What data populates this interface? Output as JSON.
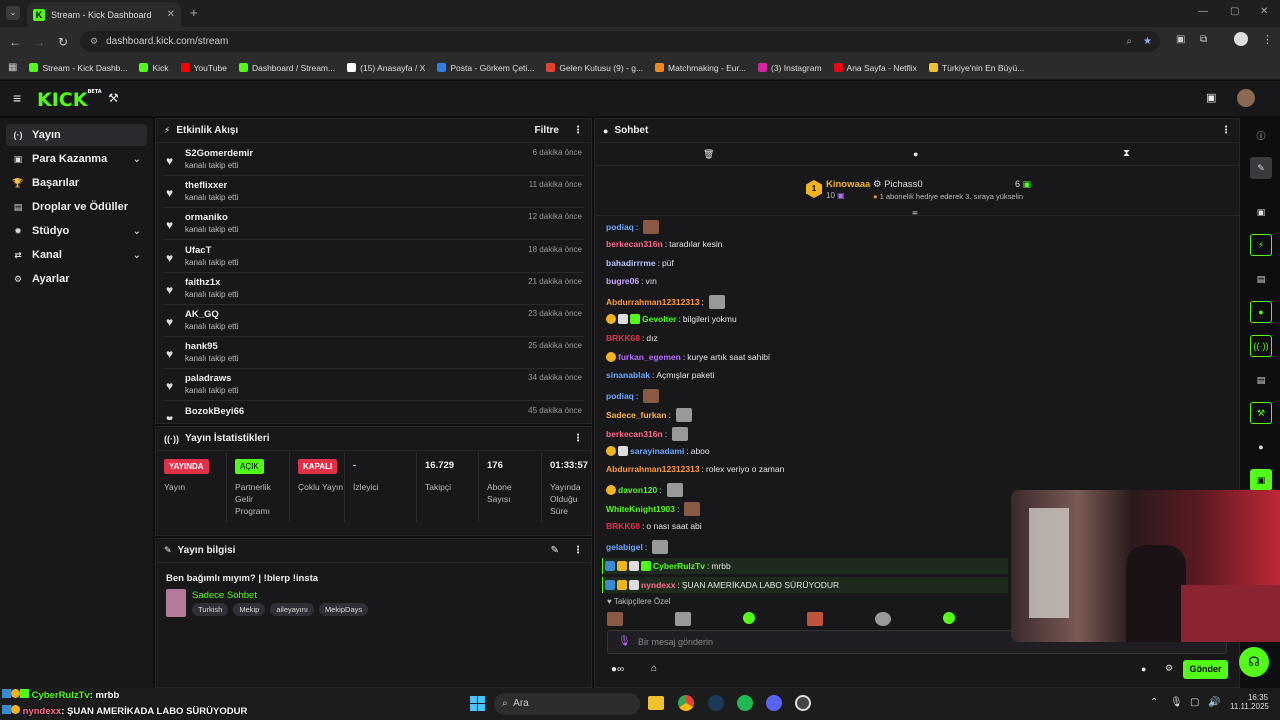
{
  "browser": {
    "tab_title": "Stream - Kick Dashboard",
    "url": "dashboard.kick.com/stream",
    "bookmarks": [
      {
        "label": "Stream - Kick Dashb...",
        "color": "#53fc18"
      },
      {
        "label": "Kick",
        "color": "#53fc18"
      },
      {
        "label": "YouTube",
        "color": "#ff0000"
      },
      {
        "label": "Dashboard / Stream...",
        "color": "#53fc18"
      },
      {
        "label": "(15) Anasayfa / X",
        "color": "#ffffff"
      },
      {
        "label": "Posta - Görkem Çeti...",
        "color": "#2f7fe6"
      },
      {
        "label": "Gelen Kutusu (9) - g...",
        "color": "#e34133"
      },
      {
        "label": "Matchmaking - Eur...",
        "color": "#f08a1c"
      },
      {
        "label": "(3) Instagram",
        "color": "#d6249f"
      },
      {
        "label": "Ana Sayfa - Netflix",
        "color": "#e50914"
      },
      {
        "label": "Türkiye'nin En Büyü...",
        "color": "#f2c12e"
      }
    ]
  },
  "header": {
    "logo": "KICK",
    "logo_tag": "BETA"
  },
  "sidebar": {
    "items": [
      {
        "label": "Yayın",
        "icon": "(·)",
        "chevron": false
      },
      {
        "label": "Para Kazanma",
        "icon": "▣",
        "chevron": true
      },
      {
        "label": "Başarılar",
        "icon": "🏆",
        "chevron": false
      },
      {
        "label": "Droplar ve Ödüller",
        "icon": "▤",
        "chevron": false
      },
      {
        "label": "Stüdyo",
        "icon": "✹",
        "chevron": true
      },
      {
        "label": "Kanal",
        "icon": "⇄",
        "chevron": true
      },
      {
        "label": "Ayarlar",
        "icon": "⚙",
        "chevron": false
      }
    ]
  },
  "activity": {
    "title": "Etkinlik Akışı",
    "filter": "Filtre",
    "items": [
      {
        "name": "S2Gomerdemir",
        "action": "kanalı takip etti",
        "time": "6 dakika önce"
      },
      {
        "name": "theflixxer",
        "action": "kanalı takip etti",
        "time": "11 dakika önce"
      },
      {
        "name": "ormaniko",
        "action": "kanalı takip etti",
        "time": "12 dakika önce"
      },
      {
        "name": "UfacT",
        "action": "kanalı takip etti",
        "time": "18 dakika önce"
      },
      {
        "name": "faithz1x",
        "action": "kanalı takip etti",
        "time": "21 dakika önce"
      },
      {
        "name": "AK_GQ",
        "action": "kanalı takip etti",
        "time": "23 dakika önce"
      },
      {
        "name": "hank95",
        "action": "kanalı takip etti",
        "time": "25 dakika önce"
      },
      {
        "name": "paladraws",
        "action": "kanalı takip etti",
        "time": "34 dakika önce"
      },
      {
        "name": "BozokBeyi66",
        "action": "",
        "time": "45 dakika önce"
      }
    ]
  },
  "stats": {
    "title": "Yayın İstatistikleri",
    "cols": [
      {
        "top": "YAYINDA",
        "top_style": "red",
        "label": "Yayın"
      },
      {
        "top": "AÇIK",
        "top_style": "green",
        "label": "Partnerlik Gelir Programı"
      },
      {
        "top": "KAPALI",
        "top_style": "red",
        "label": "Çoklu Yayın"
      },
      {
        "top": "-",
        "top_style": "text",
        "label": "İzleyici"
      },
      {
        "top": "16.729",
        "top_style": "text",
        "label": "Takipçi"
      },
      {
        "top": "176",
        "top_style": "text",
        "label": "Abone Sayısı"
      },
      {
        "top": "01:33:57",
        "top_style": "text",
        "label": "Yayında Olduğu Süre"
      }
    ]
  },
  "stream_info": {
    "title": "Yayın bilgisi",
    "stream_title": "Ben bağımlı mıyım? | !blerp !insta",
    "category": "Sadece Sohbet",
    "tags": [
      "Turkish",
      "Mekip",
      "aileyayını",
      "MekipDays"
    ]
  },
  "chat": {
    "title": "Sohbet",
    "top_gifter": {
      "name": "Kinowaaa",
      "count": "10"
    },
    "second": {
      "name": "Pichass0",
      "count": "6",
      "note": "1 abonelik hediye ederek 3. sıraya yükselin"
    },
    "messages": [
      {
        "user": "podiaq",
        "color": "#6aa8ff",
        "text": "",
        "emote": true,
        "badges": 0
      },
      {
        "user": "berkecan316n",
        "color": "#ff6b8b",
        "text": "taradılar kesin",
        "emote": false,
        "badges": 0
      },
      {
        "user": "bahadirrrme",
        "color": "#b0c4ff",
        "text": "püf",
        "emote": false,
        "badges": 0
      },
      {
        "user": "bugre06",
        "color": "#c9a8ff",
        "text": "vın",
        "emote": false,
        "badges": 0
      },
      {
        "user": "Abdurrahman12312313",
        "color": "#ff9a3c",
        "text": "",
        "emote": true,
        "badges": 0
      },
      {
        "user": "Gevolter",
        "color": "#53fc18",
        "text": "bilgileri yokmu",
        "emote": false,
        "badges": 3
      },
      {
        "user": "BRKK68",
        "color": "#e0304a",
        "text": "dız",
        "emote": false,
        "badges": 0
      },
      {
        "user": "furkan_egemen",
        "color": "#b86bff",
        "text": "kurye artık saat sahibi",
        "emote": false,
        "badges": 1
      },
      {
        "user": "sinanablak",
        "color": "#6aa8ff",
        "text": "Açmışlar paketi",
        "emote": false,
        "badges": 0
      },
      {
        "user": "podiaq",
        "color": "#6aa8ff",
        "text": "",
        "emote": true,
        "badges": 0
      },
      {
        "user": "Sadece_furkan",
        "color": "#ffb347",
        "text": "",
        "emote": true,
        "badges": 0
      },
      {
        "user": "berkecan316n",
        "color": "#ff6b8b",
        "text": "",
        "emote": true,
        "badges": 0
      },
      {
        "user": "sarayinadami",
        "color": "#6aa8ff",
        "text": "aboo",
        "emote": false,
        "badges": 2
      },
      {
        "user": "Abdurrahman12312313",
        "color": "#ff9a3c",
        "text": "rolex veriyo o zaman",
        "emote": false,
        "badges": 0
      },
      {
        "user": "davon120",
        "color": "#53fc18",
        "text": "",
        "emote": true,
        "badges": 1
      },
      {
        "user": "WhiteKnight1903",
        "color": "#53fc18",
        "text": "",
        "emote": true,
        "badges": 0
      },
      {
        "user": "BRKK68",
        "color": "#e0304a",
        "text": "o nası saat abi",
        "emote": false,
        "badges": 0
      },
      {
        "user": "gelabigel",
        "color": "#6aa8ff",
        "text": "",
        "emote": true,
        "badges": 0
      },
      {
        "user": "CyberRulzTv",
        "color": "#53fc18",
        "text": "mrbb",
        "emote": false,
        "badges": 4
      },
      {
        "user": "nyndexx",
        "color": "#ff6b8b",
        "text": "ŞUAN AMERİKADA LABO SÜRÜYODUR",
        "emote": false,
        "badges": 3
      }
    ],
    "followers_only": "Takipçilere Özel",
    "input_placeholder": "Bir mesaj gönderin",
    "send": "Gönder"
  },
  "overlay": {
    "line1_user": "CyberRulzTv",
    "line1_text": ": mrbb",
    "line2_user": "nyndexx",
    "line2_text": ": ŞUAN AMERİKADA LABO SÜRÜYODUR"
  },
  "taskbar": {
    "search": "Ara",
    "time": "16:35",
    "date": "11.11.2025"
  }
}
